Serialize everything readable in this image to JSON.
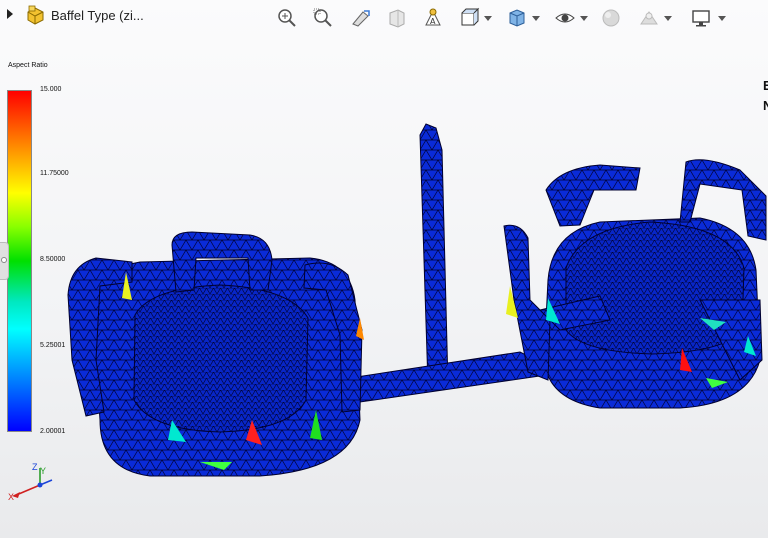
{
  "document": {
    "title": "Baffel Type (zi..."
  },
  "toolbar": {
    "items": [
      {
        "name": "zoom-to-fit-icon"
      },
      {
        "name": "zoom-to-area-icon"
      },
      {
        "name": "previous-view-icon"
      },
      {
        "name": "section-view-icon"
      },
      {
        "name": "dynamic-annotation-icon"
      },
      {
        "name": "view-orientation-icon"
      },
      {
        "name": "display-style-icon"
      },
      {
        "name": "hide-show-items-icon"
      },
      {
        "name": "edit-appearance-icon"
      },
      {
        "name": "apply-scene-icon"
      },
      {
        "name": "view-settings-icon"
      }
    ]
  },
  "legend": {
    "title": "Aspect Ratio",
    "ticks": [
      "15.000",
      "11.75000",
      "8.50000",
      "5.25001",
      "2.00001"
    ],
    "colors": [
      "#ff0000",
      "#ffff00",
      "#00e000",
      "#00ffff",
      "#0000ff"
    ]
  },
  "right_edge": {
    "line1": "E",
    "line2": "N"
  },
  "triad": {
    "x": "X",
    "y": "Y",
    "z": "Z"
  },
  "colors": {
    "mesh_fill": "#0a2bd8",
    "mesh_edge": "#000030"
  }
}
